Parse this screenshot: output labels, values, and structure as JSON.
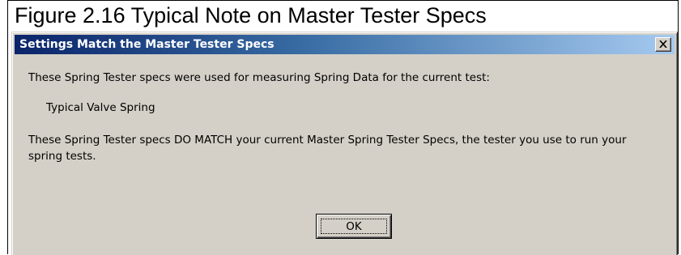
{
  "caption": "Figure 2.16 Typical Note on Master Tester Specs",
  "dialog": {
    "title": "Settings Match the Master Tester Specs",
    "close_icon": "close-x-icon",
    "message_line1": "These Spring Tester specs were used for measuring Spring Data for the current test:",
    "spring_name": "Typical Valve Spring",
    "message_line2": "These Spring Tester specs DO MATCH your current Master Spring Tester Specs, the tester you use to run your spring tests.",
    "ok_label": "OK"
  },
  "colors": {
    "titlebar_start": "#0a246a",
    "titlebar_end": "#a6caf0",
    "dialog_face": "#d4d0c8"
  }
}
